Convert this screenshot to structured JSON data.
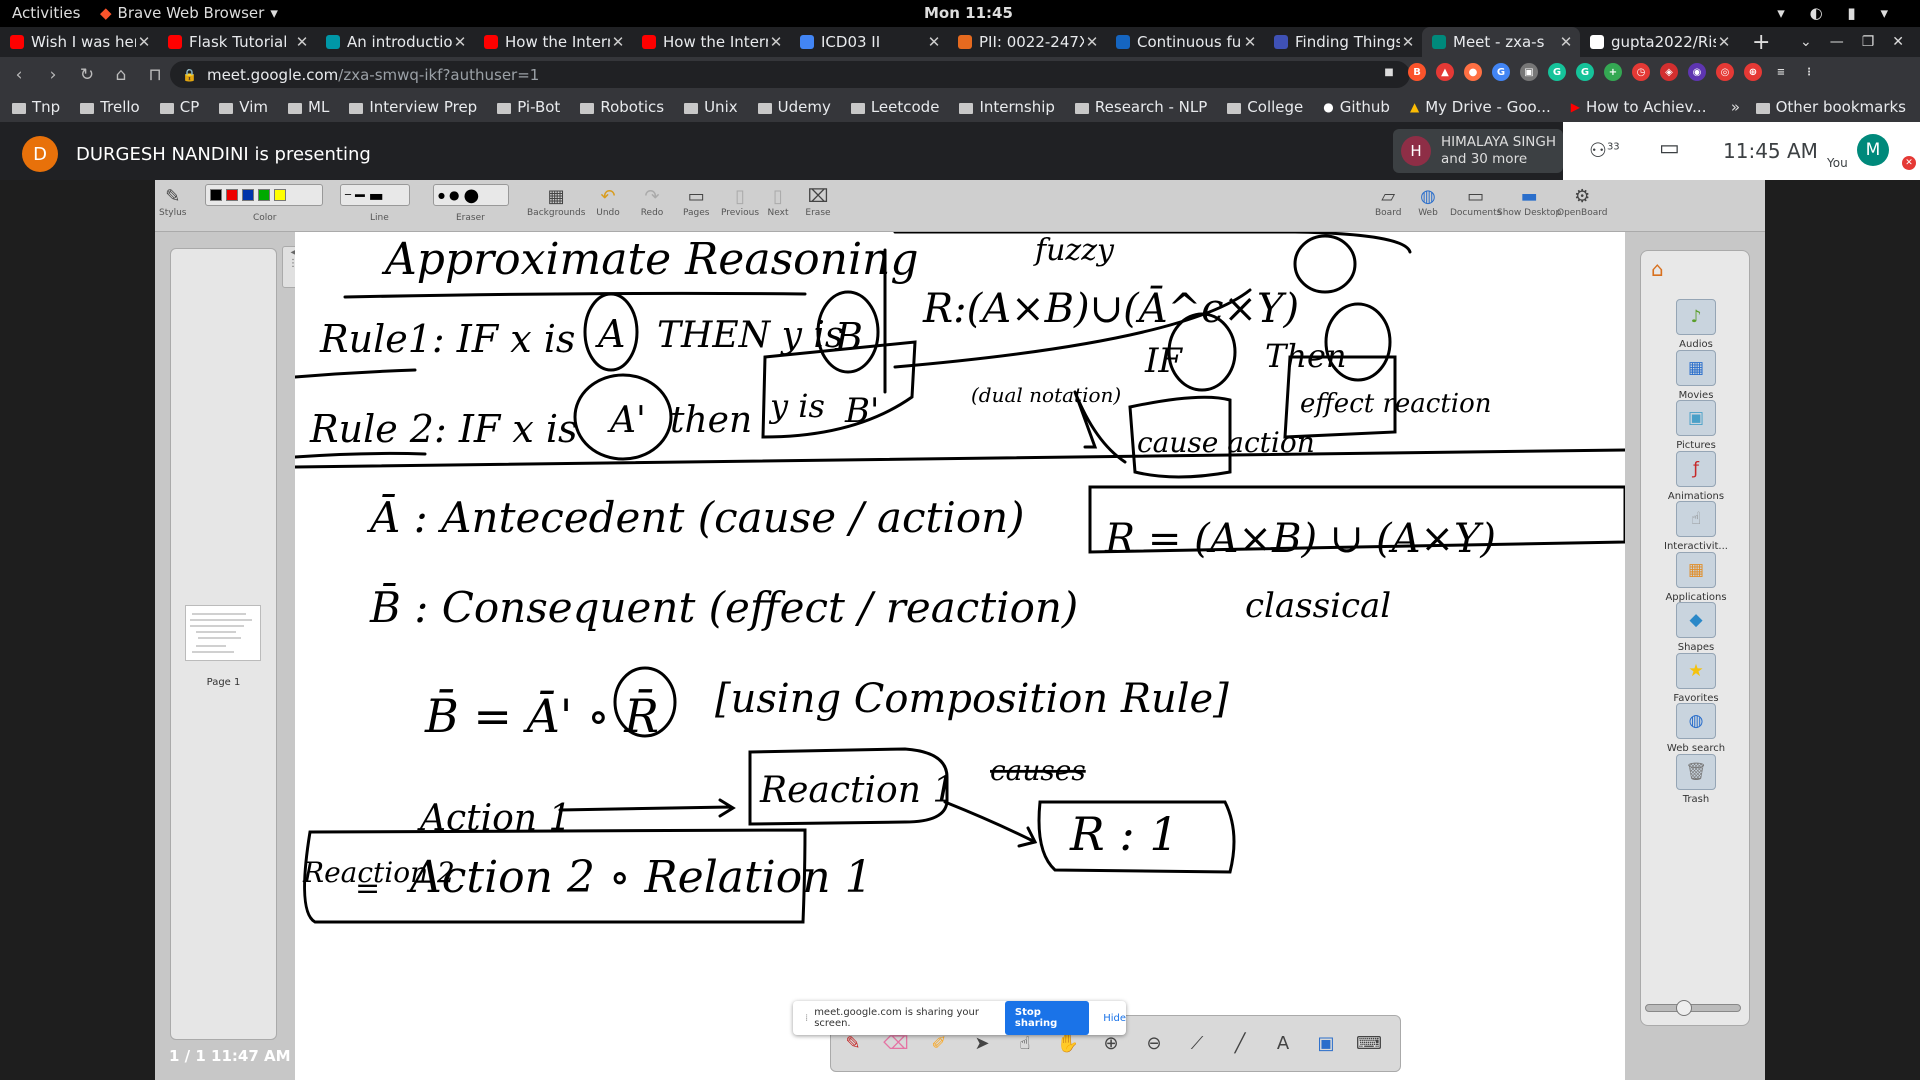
{
  "gnome": {
    "activities": "Activities",
    "app": "Brave Web Browser",
    "clock": "Mon 11:45"
  },
  "tabs": [
    {
      "title": "Wish I was here",
      "color": "#ff0000",
      "icon": "youtube-icon"
    },
    {
      "title": "Flask Tutorial",
      "color": "#ff0000",
      "icon": "youtube-icon"
    },
    {
      "title": "An introduction",
      "color": "#0097a7",
      "icon": "site-icon"
    },
    {
      "title": "How the Intern",
      "color": "#ff0000",
      "icon": "youtube-icon"
    },
    {
      "title": "How the Intern",
      "color": "#ff0000",
      "icon": "youtube-icon"
    },
    {
      "title": "ICD03 II",
      "color": "#4285f4",
      "icon": "slides-icon"
    },
    {
      "title": "PII: 0022-247X(",
      "color": "#e66a1f",
      "icon": "elsevier-icon"
    },
    {
      "title": "Continuous fu",
      "color": "#1565c0",
      "icon": "ieee-icon"
    },
    {
      "title": "Finding Things",
      "color": "#3f51b5",
      "icon": "power-icon"
    },
    {
      "title": "Meet - zxa-s",
      "color": "#00897b",
      "icon": "meet-icon"
    },
    {
      "title": "gupta2022/Ris",
      "color": "#ffffff",
      "icon": "github-icon"
    }
  ],
  "toolbar": {
    "url_host": "meet.google.com",
    "url_path": "/zxa-smwq-ikf?authuser=1"
  },
  "bookmarks": [
    "Tnp",
    "Trello",
    "CP",
    "Vim",
    "ML",
    "Interview Prep",
    "Pi-Bot",
    "Robotics",
    "Unix",
    "Udemy",
    "Leetcode",
    "Internship",
    "Research - NLP",
    "College"
  ],
  "bookmark_links": [
    "Github",
    "My Drive - Goo...",
    "How to Achiev..."
  ],
  "bookmark_other": "Other bookmarks",
  "meet": {
    "presenter_initial": "D",
    "presenter": "DURGESH NANDINI is presenting",
    "participant_initial": "H",
    "participant_name": "HIMALAYA SINGH",
    "participant_more": "and 30 more",
    "people_count": "33",
    "time": "11:45 AM",
    "you": "You",
    "me_initial": "M"
  },
  "openboard": {
    "tools": [
      "Stylus",
      "Color",
      "Line",
      "Eraser",
      "Backgrounds",
      "Undo",
      "Redo",
      "Pages",
      "Previous",
      "Next",
      "Erase",
      "Board",
      "Web",
      "Documents",
      "Show Desktop",
      "OpenBoard"
    ],
    "page_label": "Page 1",
    "page_counter": "1 / 1 11:47 AM",
    "library": [
      "Audios",
      "Movies",
      "Pictures",
      "Animations",
      "Interactivit...",
      "Applications",
      "Shapes",
      "Favorites",
      "Web search",
      "Trash"
    ]
  },
  "whiteboard": {
    "title": "Approximate Reasoning",
    "fuzzy": "fuzzy",
    "rule1_prefix": "Rule1: IF x is",
    "rule1_a": "A",
    "rule1_then": "THEN y is",
    "rule1_b": "B",
    "relation": "R:(A×B)∪(Ā^c×Y)",
    "rule2_prefix": "Rule 2: IF x is",
    "rule2_a": "A'",
    "rule2_then": "then",
    "rule2_y": "y is",
    "rule2_b": "B'",
    "dual": "(dual notation)",
    "if_label": "IF",
    "then_label": "Then",
    "cause_action": "cause action",
    "effect_reaction": "effect reaction",
    "antecedent": "Ā : Antecedent (cause / action)",
    "consequent": "B̄ : Consequent (effect / reaction)",
    "classical_relation": "R = (A×B) ∪ (A×Y)",
    "classical": "classical",
    "composition_eq": "B̄ = Ā' ∘ R̄",
    "composition_note": "[using Composition Rule]",
    "action1": "Action 1",
    "reaction1": "Reaction 1",
    "causes": "causes",
    "r1": "R : 1",
    "reaction2": "Reaction 2",
    "eq": "=",
    "action2": "Action 2 ∘ Relation 1"
  },
  "sharebar": {
    "text": "meet.google.com is sharing your screen.",
    "stop": "Stop sharing",
    "hide": "Hide"
  }
}
